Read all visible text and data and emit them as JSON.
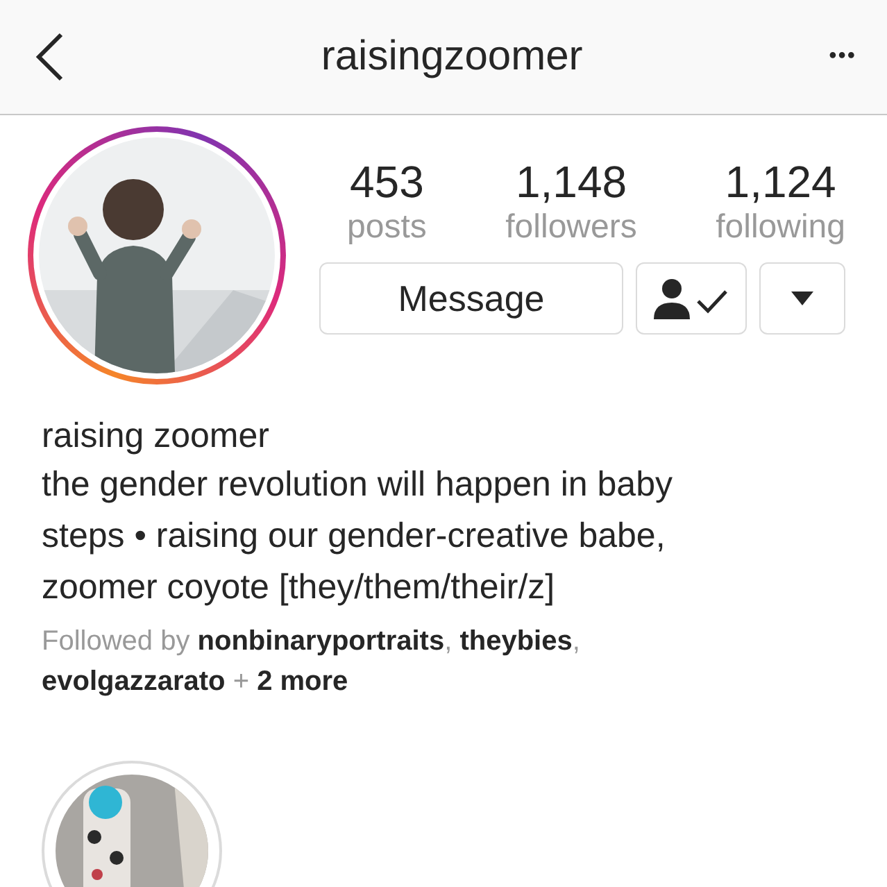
{
  "header": {
    "title": "raisingzoomer",
    "more": "•••"
  },
  "profile": {
    "avatar": {
      "kind": "picture",
      "has_story": true
    },
    "stats": [
      {
        "value": "453",
        "label": "posts"
      },
      {
        "value": "1,148",
        "label": "followers"
      },
      {
        "value": "1,124",
        "label": "following"
      }
    ],
    "buttons": {
      "message": "Message",
      "following": true
    },
    "name": "raising zoomer",
    "bio": "the gender revolution will happen in baby steps • raising our gender-creative babe, zoomer coyote [they/them/their/z]",
    "followed_by": "Followed by **nonbinaryportraits**, **theybies**, **evolgazzarato** + **2 more**"
  },
  "highlights": [
    {
      "kind": "picture"
    }
  ]
}
